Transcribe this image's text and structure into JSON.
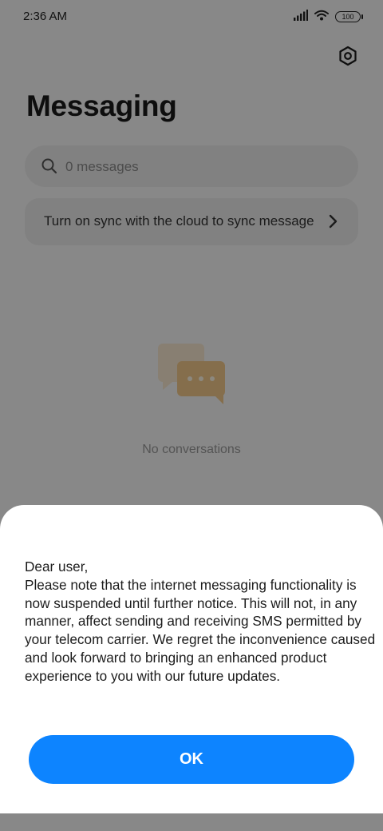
{
  "status_bar": {
    "time": "2:36 AM",
    "battery": "100",
    "icons": [
      "signal-icon",
      "wifi-icon",
      "battery-icon"
    ]
  },
  "header": {
    "settings_icon": "settings-icon",
    "title": "Messaging"
  },
  "search": {
    "placeholder": "0 messages",
    "icon": "search-icon"
  },
  "sync_banner": {
    "text": "Turn on sync with the cloud to sync messages",
    "icon": "chevron-right-icon"
  },
  "empty_state": {
    "icon": "chat-bubbles-icon",
    "text": "No conversations"
  },
  "dialog": {
    "greeting": "Dear user,",
    "body": "Please note that the internet messaging functionality is now suspended until further notice. This will not, in any manner, affect sending and receiving SMS permit­ted by your telecom carrier. We regret the inconveni­ence caused and look forward to bringing an enhanced product experience to you with our future updates.",
    "ok_label": "OK"
  },
  "colors": {
    "accent": "#0d84ff",
    "overlay": "rgba(0,0,0,0.45)",
    "background": "#f7f7f7",
    "illustration": "#f3c98a"
  }
}
